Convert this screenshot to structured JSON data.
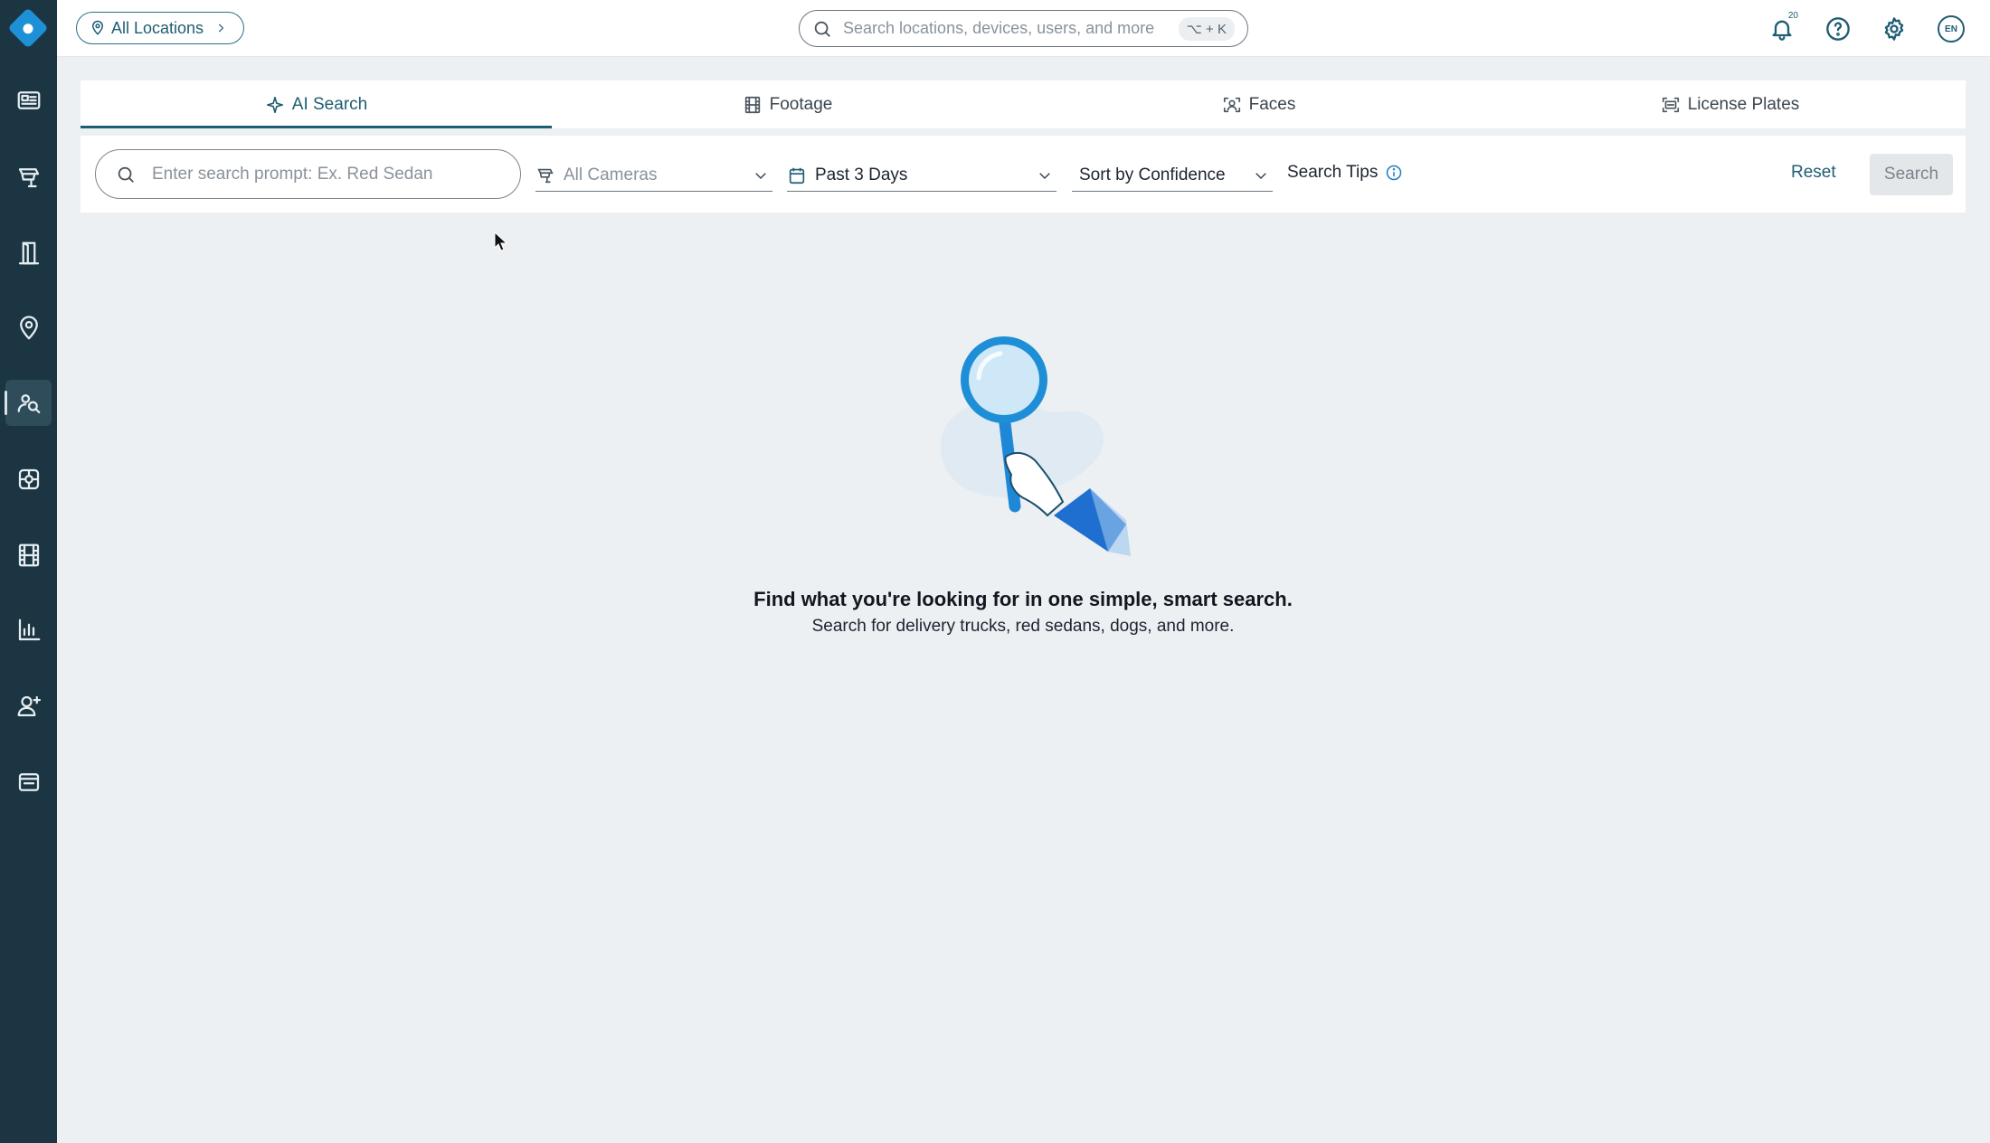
{
  "top_bar": {
    "location_label": "All Locations",
    "search_placeholder": "Search locations, devices, users, and more",
    "search_shortcut": "⌥ + K",
    "notification_count": "20",
    "language": "EN"
  },
  "sidebar": {
    "items": [
      {
        "icon": "dashboard-icon"
      },
      {
        "icon": "camera-icon"
      },
      {
        "icon": "door-access-icon"
      },
      {
        "icon": "location-pin-icon"
      },
      {
        "icon": "person-search-icon",
        "active": true
      },
      {
        "icon": "sensor-icon"
      },
      {
        "icon": "film-icon"
      },
      {
        "icon": "analytics-chart-icon"
      },
      {
        "icon": "add-user-icon"
      },
      {
        "icon": "browser-window-icon"
      }
    ]
  },
  "tabs": [
    {
      "label": "AI Search",
      "icon": "sparkle-icon",
      "active": true
    },
    {
      "label": "Footage",
      "icon": "film-icon"
    },
    {
      "label": "Faces",
      "icon": "face-scan-icon"
    },
    {
      "label": "License Plates",
      "icon": "license-plate-icon"
    }
  ],
  "filters": {
    "prompt_placeholder": "Enter search prompt: Ex. Red Sedan",
    "cameras": "All Cameras",
    "date_range": "Past 3 Days",
    "sort": "Sort by Confidence",
    "tips": "Search Tips",
    "reset": "Reset",
    "search": "Search"
  },
  "empty_state": {
    "title": "Find what you're looking for in one simple, smart search.",
    "subtitle": "Search for delivery trucks, red sedans, dogs, and more."
  },
  "colors": {
    "sidebar": "#1b3642",
    "accent": "#1e5d73",
    "brand_blue": "#1e90d6",
    "background": "#edf0f3"
  }
}
